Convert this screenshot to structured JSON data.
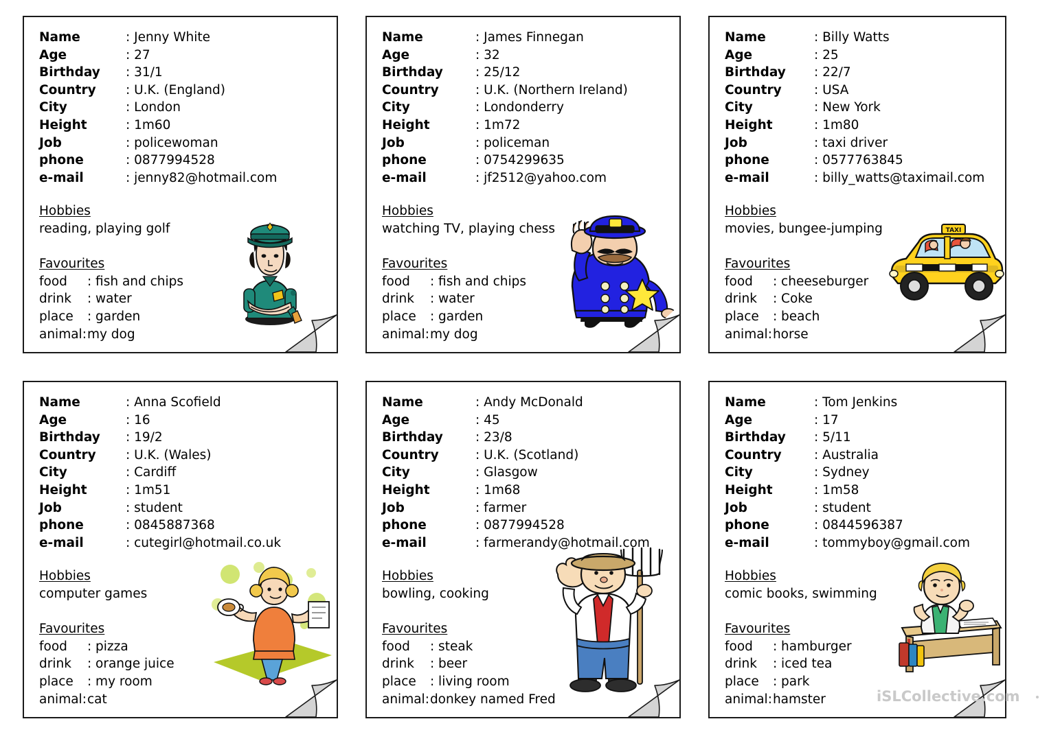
{
  "watermark": {
    "text": "iSLCollective.com"
  },
  "field_labels": {
    "name": "Name",
    "age": "Age",
    "birthday": "Birthday",
    "country": "Country",
    "city": "City",
    "height": "Height",
    "job": "Job",
    "phone": "phone",
    "email": "e-mail"
  },
  "section_labels": {
    "hobbies": "Hobbies",
    "favourites": "Favourites",
    "food": "food",
    "drink": "drink",
    "place": "place",
    "animal": "animal:"
  },
  "separator": ":",
  "food_sep": ":",
  "cards": [
    {
      "id": "jenny-white",
      "art": "policewoman",
      "name": ": Jenny White",
      "age": ": 27",
      "birthday": ": 31/1",
      "country": ": U.K. (England)",
      "city": ": London",
      "height": ": 1m60",
      "job": ": policewoman",
      "phone": ": 0877994528",
      "email": ": jenny82@hotmail.com",
      "hobbies": "reading, playing golf",
      "food": ": fish and chips",
      "drink": ": water",
      "place": ": garden",
      "animal": "my dog"
    },
    {
      "id": "james-finnegan",
      "art": "policeman",
      "name": ": James Finnegan",
      "age": ": 32",
      "birthday": ": 25/12",
      "country": ": U.K. (Northern Ireland)",
      "city": ": Londonderry",
      "height": ": 1m72",
      "job": ": policeman",
      "phone": ": 0754299635",
      "email": ": jf2512@yahoo.com",
      "hobbies": "watching TV, playing chess",
      "food": ": fish and chips",
      "drink": ": water",
      "place": ": garden",
      "animal": "my dog"
    },
    {
      "id": "billy-watts",
      "art": "taxi",
      "name": ": Billy Watts",
      "age": ": 25",
      "birthday": ": 22/7",
      "country": ": USA",
      "city": ": New York",
      "height": ": 1m80",
      "job": ": taxi driver",
      "phone": ": 0577763845",
      "email": ": billy_watts@taximail.com",
      "hobbies": "movies, bungee-jumping",
      "food": ": cheeseburger",
      "drink": ": Coke",
      "place": ": beach",
      "animal": "horse"
    },
    {
      "id": "anna-scofield",
      "art": "girl-computer",
      "name": ": Anna Scofield",
      "age": ": 16",
      "birthday": ": 19/2",
      "country": ": U.K. (Wales)",
      "city": ": Cardiff",
      "height": ": 1m51",
      "job": ": student",
      "phone": ": 0845887368",
      "email": ": cutegirl@hotmail.co.uk",
      "hobbies": "computer games",
      "food": ": pizza",
      "drink": ": orange juice",
      "place": ": my room",
      "animal": "cat"
    },
    {
      "id": "andy-mcdonald",
      "art": "farmer",
      "name": ": Andy McDonald",
      "age": ": 45",
      "birthday": ": 23/8",
      "country": ": U.K. (Scotland)",
      "city": ": Glasgow",
      "height": ": 1m68",
      "job": ": farmer",
      "phone": ": 0877994528",
      "email": ": farmerandy@hotmail.com",
      "hobbies": "bowling, cooking",
      "food": ": steak",
      "drink": ": beer",
      "place": ": living room",
      "animal": "donkey named Fred"
    },
    {
      "id": "tom-jenkins",
      "art": "boy-desk",
      "name": ": Tom Jenkins",
      "age": ": 17",
      "birthday": ": 5/11",
      "country": ": Australia",
      "city": ": Sydney",
      "height": ": 1m58",
      "job": ": student",
      "phone": ": 0844596387",
      "email": ": tommyboy@gmail.com",
      "hobbies": "comic books, swimming",
      "food": ": hamburger",
      "drink": ": iced tea",
      "place": ": park",
      "animal": "hamster"
    }
  ],
  "colors": {
    "border": "#1a1a1a",
    "text": "#000000",
    "curl_fill": "#d4d4d4",
    "watermark": "#c9c9c9",
    "police_teal": "#1f8a7a",
    "police_blue": "#2222e0",
    "taxi_yellow": "#ffd21e",
    "farmer_red": "#cc2222",
    "green_accent": "#b5d334"
  }
}
